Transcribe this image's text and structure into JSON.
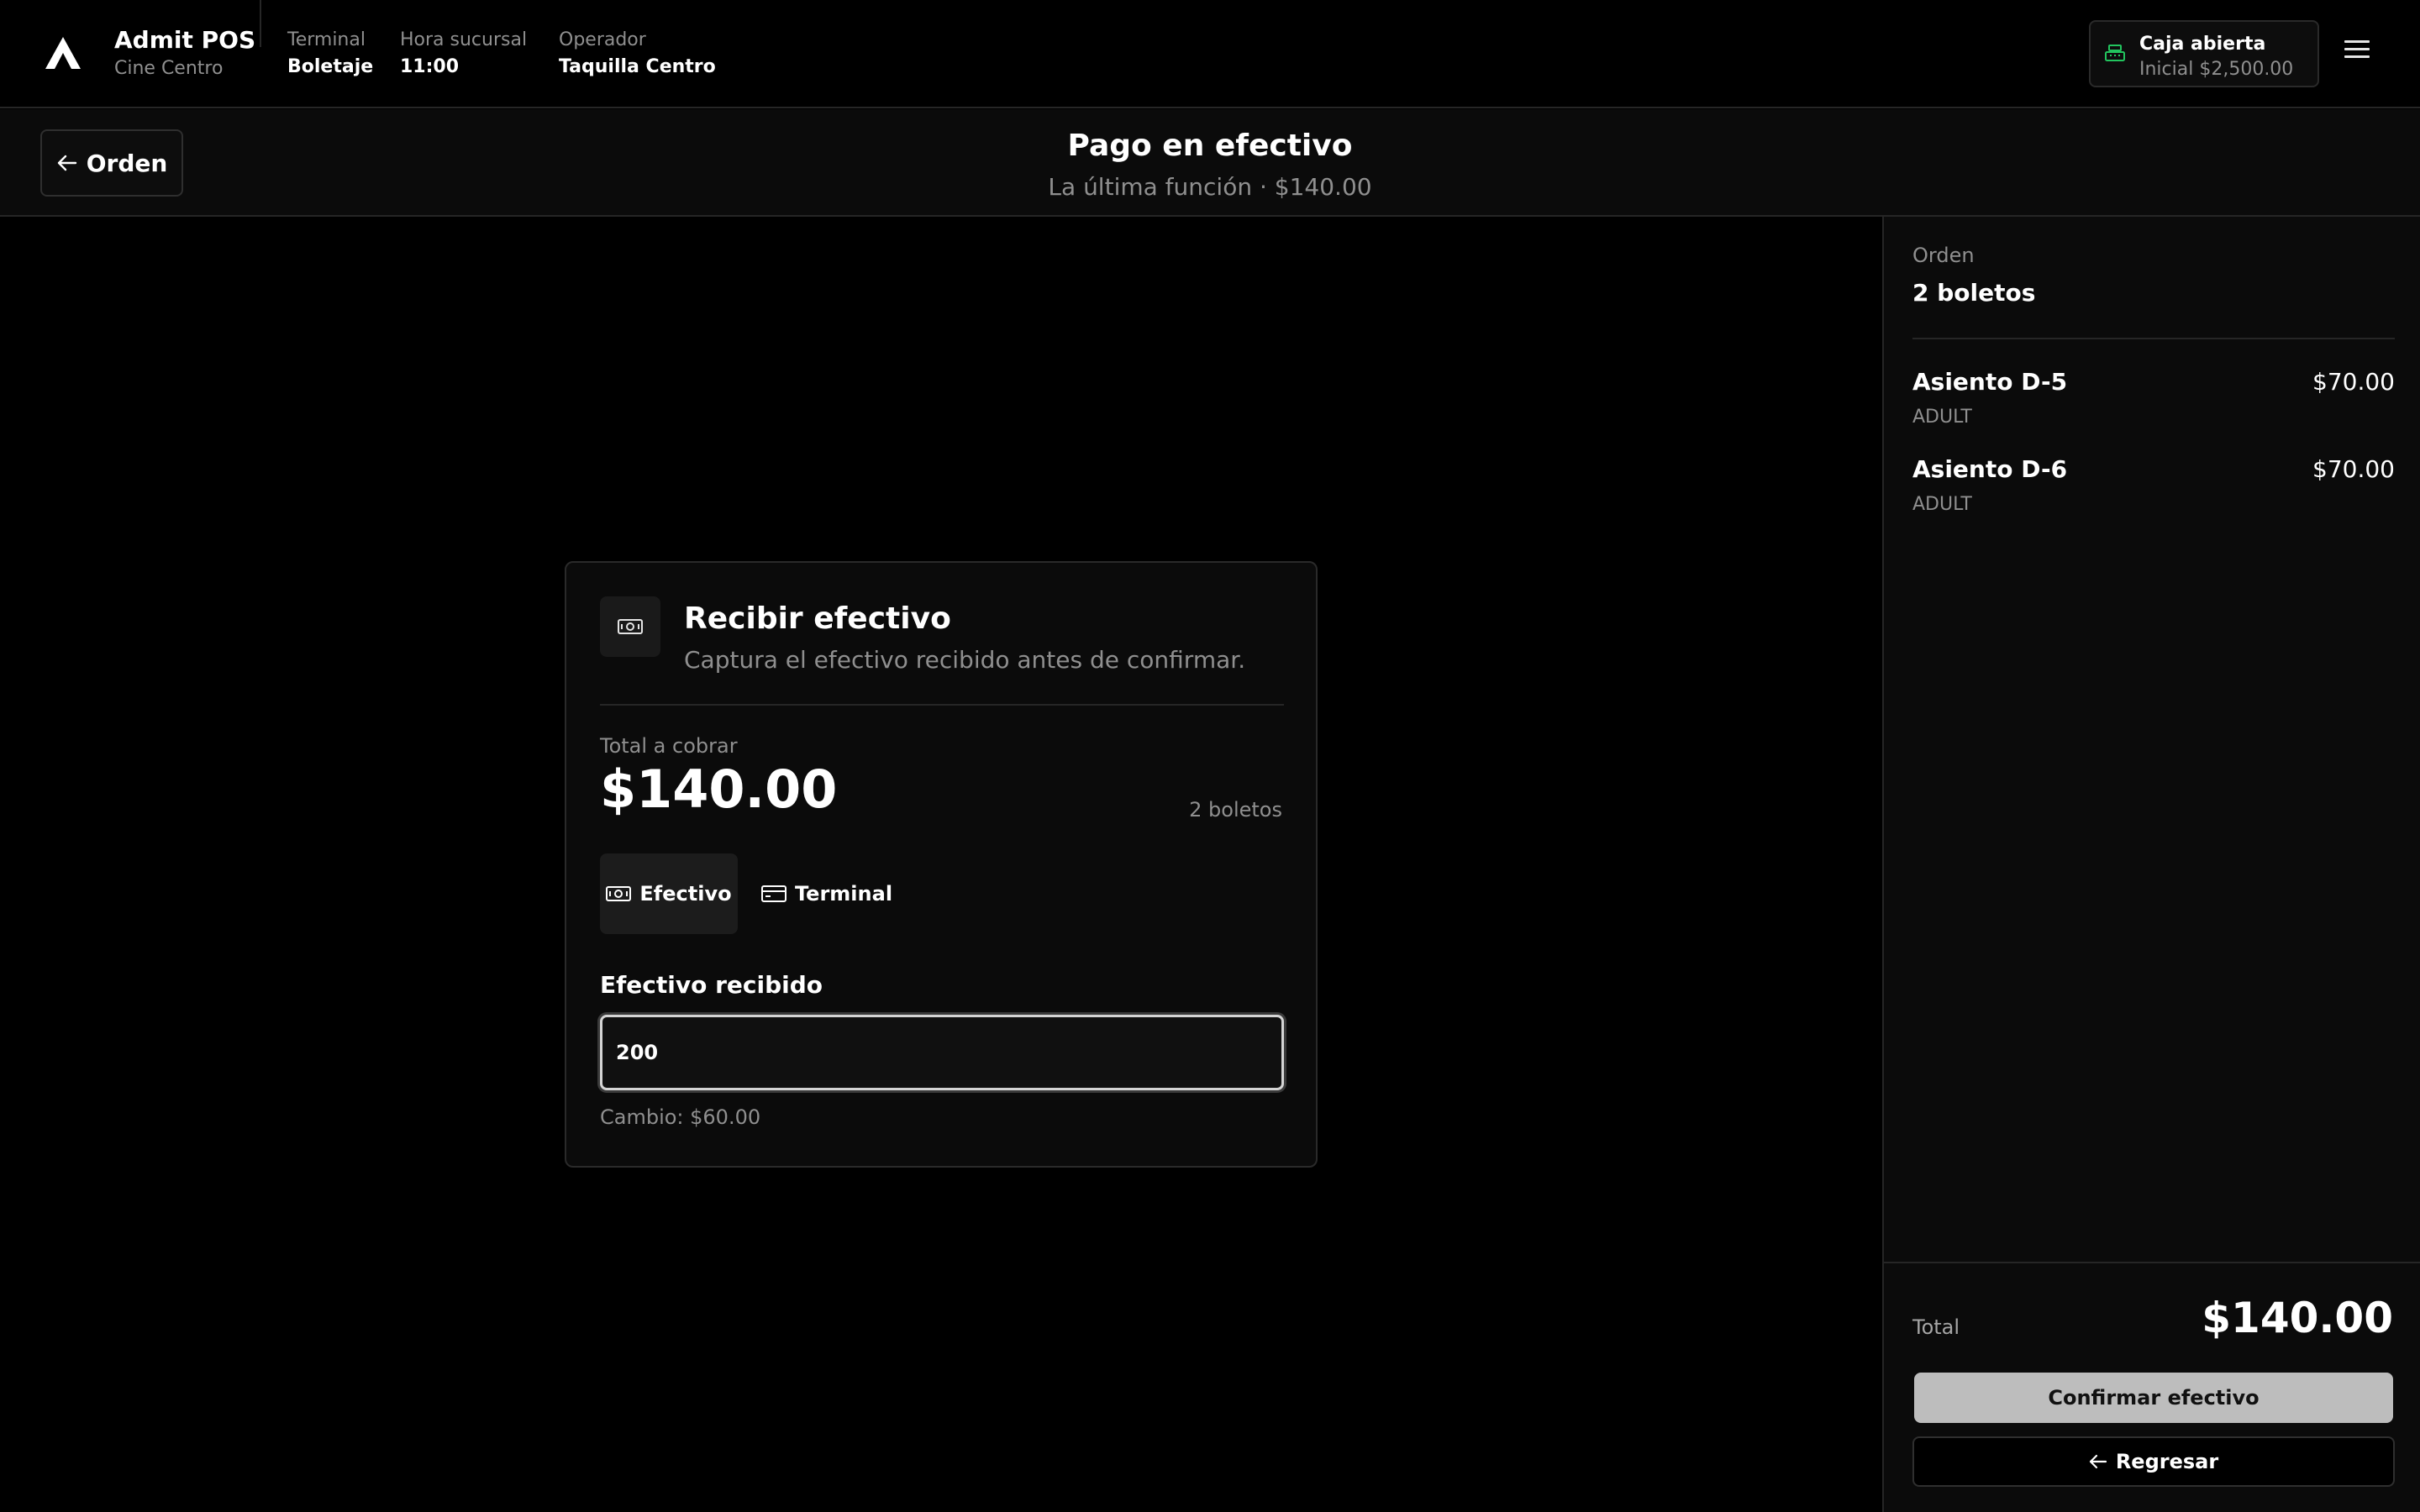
{
  "topbar": {
    "app_name": "Admit POS",
    "branch": "Cine Centro",
    "meta": [
      {
        "label": "Terminal",
        "value": "Boletaje"
      },
      {
        "label": "Hora sucursal",
        "value": "11:00"
      },
      {
        "label": "Operador",
        "value": "Taquilla Centro"
      }
    ],
    "cash_status": {
      "title": "Caja abierta",
      "detail": "Inicial $2,500.00",
      "icon": "register-icon",
      "icon_color": "#22c55e"
    },
    "menu_icon": "hamburger-menu-icon"
  },
  "subheader": {
    "back_label": "Orden",
    "title": "Pago en efectivo",
    "subtitle": "La última función · $140.00"
  },
  "card": {
    "icon": "cash-icon",
    "title": "Recibir efectivo",
    "subtitle": "Captura el efectivo recibido antes de confirmar.",
    "total_label": "Total a cobrar",
    "total_value": "$140.00",
    "count": "2 boletos",
    "methods": [
      {
        "label": "Efectivo",
        "icon": "cash-icon",
        "active": true
      },
      {
        "label": "Terminal",
        "icon": "card-icon",
        "active": false
      }
    ],
    "field_label": "Efectivo recibido",
    "field_value": "200",
    "change": "Cambio: $60.00"
  },
  "order": {
    "label": "Orden",
    "count": "2 boletos",
    "items": [
      {
        "seat": "Asiento D-5",
        "type": "ADULT",
        "price": "$70.00"
      },
      {
        "seat": "Asiento D-6",
        "type": "ADULT",
        "price": "$70.00"
      }
    ],
    "total_label": "Total",
    "total_value": "$140.00",
    "confirm_label": "Confirmar efectivo",
    "return_label": "Regresar"
  }
}
